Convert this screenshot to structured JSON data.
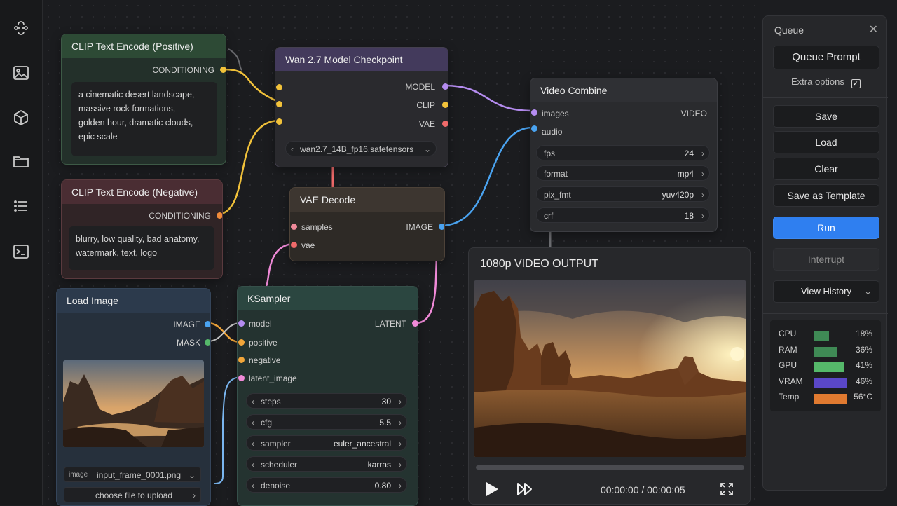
{
  "nodes": {
    "clip_pos": {
      "title": "CLIP Text Encode (Positive)",
      "output": "CONDITIONING",
      "text_lines": [
        "a cinematic desert landscape,",
        "massive rock formations,",
        "golden hour, dramatic clouds,",
        "epic scale"
      ]
    },
    "clip_neg": {
      "title": "CLIP Text Encode (Negative)",
      "output": "CONDITIONING",
      "text_lines": [
        "blurry, low quality, bad anatomy,",
        "watermark, text, logo"
      ]
    },
    "checkpoint": {
      "title": "Wan 2.7 Model Checkpoint",
      "outputs": [
        "MODEL",
        "CLIP",
        "VAE"
      ],
      "ckpt_name": "wan2.7_14B_fp16.safetensors"
    },
    "vae_decode": {
      "title": "VAE Decode",
      "inputs": [
        "samples",
        "vae"
      ],
      "output": "IMAGE"
    },
    "video_combine": {
      "title": "Video Combine",
      "inputs": [
        "images",
        "audio"
      ],
      "output": "VIDEO",
      "widgets": [
        {
          "label": "fps",
          "value": "24"
        },
        {
          "label": "format",
          "value": "mp4"
        },
        {
          "label": "pix_fmt",
          "value": "yuv420p"
        },
        {
          "label": "crf",
          "value": "18"
        }
      ]
    },
    "load_image": {
      "title": "Load Image",
      "outputs": [
        "IMAGE",
        "MASK"
      ],
      "image_label": "image",
      "image_file": "input_frame_0001.png",
      "upload_label": "choose file to upload"
    },
    "ksampler": {
      "title": "KSampler",
      "inputs": [
        "model",
        "positive",
        "negative",
        "latent_image"
      ],
      "output": "LATENT",
      "widgets": [
        {
          "label": "steps",
          "value": "30"
        },
        {
          "label": "cfg",
          "value": "5.5"
        },
        {
          "label": "sampler",
          "value": "euler_ancestral"
        },
        {
          "label": "scheduler",
          "value": "karras"
        },
        {
          "label": "denoise",
          "value": "0.80"
        }
      ]
    }
  },
  "video_output": {
    "title": "1080p VIDEO OUTPUT",
    "time": "00:00:00 / 00:00:05",
    "progress": 0.0
  },
  "queue": {
    "title": "Queue",
    "queue_prompt": "Queue Prompt",
    "extra_options": "Extra options",
    "extra_options_checked": true,
    "save": "Save",
    "load": "Load",
    "clear": "Clear",
    "save_template": "Save as Template",
    "run": "Run",
    "interrupt": "Interrupt",
    "view_history": "View History",
    "stats": [
      {
        "label": "CPU",
        "value": "18%",
        "fraction": 0.45,
        "color": "#3f8a55"
      },
      {
        "label": "RAM",
        "value": "36%",
        "fraction": 0.68,
        "color": "#3f8a55"
      },
      {
        "label": "GPU",
        "value": "41%",
        "fraction": 0.9,
        "color": "#55b86a"
      },
      {
        "label": "VRAM",
        "value": "46%",
        "fraction": 1.0,
        "color": "#5a47c8"
      },
      {
        "label": "Temp",
        "value": "56°C",
        "fraction": 1.0,
        "color": "#e07a30"
      }
    ]
  },
  "colors": {
    "accent": "#2f7ff0",
    "model_wire": "#b58cf0",
    "clip_wire": "#f2c23a",
    "vae_wire": "#f06a6a",
    "image_wire": "#4aa3f0",
    "latent_wire": "#f08ad8",
    "conditioning_wire": "#f2a63a"
  }
}
